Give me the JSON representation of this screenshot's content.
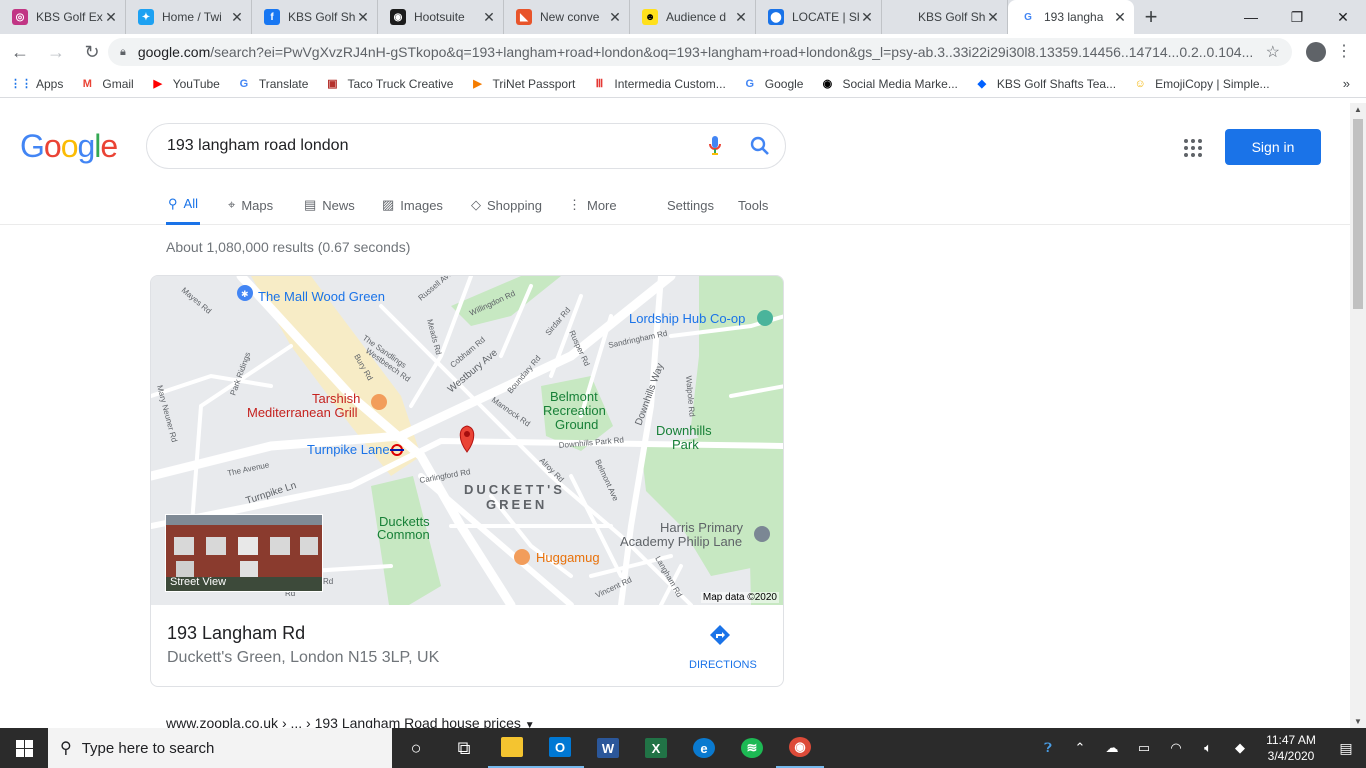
{
  "browser": {
    "tabs": [
      {
        "title": "KBS Golf Ex",
        "icon": "instagram-icon",
        "color": "#c13584",
        "glyph": "◎"
      },
      {
        "title": "Home / Twi",
        "icon": "twitter-icon",
        "color": "#1da1f2",
        "glyph": "✦"
      },
      {
        "title": "KBS Golf Sh",
        "icon": "facebook-icon",
        "color": "#1877f2",
        "glyph": "f"
      },
      {
        "title": "Hootsuite",
        "icon": "hootsuite-icon",
        "color": "#1c1c1c",
        "glyph": "◉"
      },
      {
        "title": "New conve",
        "icon": "zendesk-icon",
        "color": "#e8542a",
        "glyph": "◣"
      },
      {
        "title": "Audience d",
        "icon": "mailchimp-icon",
        "color": "#ffe01b",
        "glyph": "☻"
      },
      {
        "title": "LOCATE | Sh",
        "icon": "location-icon",
        "color": "#1a73e8",
        "glyph": "⬤"
      },
      {
        "title": "KBS Golf Sh",
        "icon": "",
        "color": "#dee1e6",
        "glyph": ""
      },
      {
        "title": "193 langha",
        "icon": "google-icon",
        "color": "#ffffff",
        "glyph": "G",
        "active": true
      }
    ],
    "new_tab": "+",
    "url_host": "google.com",
    "url_rest": "/search?ei=PwVgXvzRJ4nH-gSTkopo&q=193+langham+road+london&oq=193+langham+road+london&gs_l=psy-ab.3..33i22i29i30l8.13359.14456..14714...0.2..0.104...",
    "bookmarks": [
      {
        "label": "Apps",
        "icon": "apps-grid-icon",
        "color": "#1a73e8",
        "glyph": "⋮⋮"
      },
      {
        "label": "Gmail",
        "icon": "gmail-icon",
        "color": "#ea4335",
        "glyph": "M"
      },
      {
        "label": "YouTube",
        "icon": "youtube-icon",
        "color": "#ff0000",
        "glyph": "▶"
      },
      {
        "label": "Translate",
        "icon": "translate-icon",
        "color": "#4285f4",
        "glyph": "G"
      },
      {
        "label": "Taco Truck Creative",
        "icon": "taco-truck-icon",
        "color": "#b5312c",
        "glyph": "▣"
      },
      {
        "label": "TriNet Passport",
        "icon": "trinet-icon",
        "color": "#f57c00",
        "glyph": "▶"
      },
      {
        "label": "Intermedia Custom...",
        "icon": "intermedia-icon",
        "color": "#e53935",
        "glyph": "Ⅲ"
      },
      {
        "label": "Google",
        "icon": "google-icon",
        "color": "#4285f4",
        "glyph": "G"
      },
      {
        "label": "Social Media Marke...",
        "icon": "hootsuite-owl-icon",
        "color": "#000000",
        "glyph": "◉"
      },
      {
        "label": "KBS Golf Shafts Tea...",
        "icon": "dropbox-icon",
        "color": "#0061ff",
        "glyph": "◆"
      },
      {
        "label": "EmojiCopy | Simple...",
        "icon": "emoji-icon",
        "color": "#f4b400",
        "glyph": "☺"
      }
    ]
  },
  "google": {
    "query": "193 langham road london",
    "sign_in": "Sign in",
    "tabs": [
      {
        "label": "All",
        "icon": "search-icon",
        "glyph": "🔍︎"
      },
      {
        "label": "Maps",
        "icon": "map-pin-icon",
        "glyph": "⌖"
      },
      {
        "label": "News",
        "icon": "news-icon",
        "glyph": "▤"
      },
      {
        "label": "Images",
        "icon": "image-icon",
        "glyph": "▨"
      },
      {
        "label": "Shopping",
        "icon": "tag-icon",
        "glyph": "◇"
      },
      {
        "label": "More",
        "icon": "more-vert-icon",
        "glyph": "⋮"
      }
    ],
    "settings": "Settings",
    "tools": "Tools",
    "stats": "About 1,080,000 results (0.67 seconds)",
    "map": {
      "labels": {
        "mall": "The Mall Wood Green",
        "coop": "Lordship Hub Co-op",
        "tarshish1": "Tarshish",
        "tarshish2": "Mediterranean Grill",
        "belmont1": "Belmont",
        "belmont2": "Recreation",
        "belmont3": "Ground",
        "downhills1": "Downhills",
        "downhills2": "Park",
        "turnpike": "Turnpike Lane",
        "duckett1": "DUCKETT'S",
        "duckett2": "GREEN",
        "common1": "Ducketts",
        "common2": "Common",
        "harris1": "Harris Primary",
        "harris2": "Academy Philip Lane",
        "huggamug": "Huggamug"
      },
      "streets": {
        "mayes": "Mayes Rd",
        "russell": "Russell Ave",
        "willingdon": "Willingdon Rd",
        "sirdar": "Sirdar Rd",
        "sandringham": "Sandringham Rd",
        "rusper": "Rusper Rd",
        "meads": "Meads Rd",
        "cobham": "Cobham Rd",
        "westbury": "Westbury Ave",
        "sandlings": "The Sandlings",
        "westbeech": "Westbeech Rd",
        "bury": "Bury Rd",
        "boundary": "Boundary Rd",
        "mannock": "Mannock Rd",
        "downhills_way": "Downhills Way",
        "walpole": "Walpole Rd",
        "park_ridings": "Park Ridings",
        "mary_neuner": "Mary Neuner Rd",
        "downhills_park_rd": "Downhills Park Rd",
        "avenue": "The Avenue",
        "carlingford": "Carlingford Rd",
        "alroy": "Alroy Rd",
        "turnpike_ln": "Turnpike Ln",
        "belmont_ave": "Belmont Ave",
        "langham": "Langham Rd",
        "vincent": "Vincent Rd",
        "rd_a": "Rd",
        "rd_b": "Rd"
      },
      "street_view": "Street View",
      "attribution": "Map data ©2020"
    },
    "place_title": "193 Langham Rd",
    "place_address": "Duckett's Green, London N15 3LP, UK",
    "directions": "DIRECTIONS",
    "next_result": "www.zoopla.co.uk › ... › 193 Langham Road house prices"
  },
  "taskbar": {
    "search_placeholder": "Type here to search",
    "apps": [
      {
        "name": "cortana-icon",
        "glyph": "○"
      },
      {
        "name": "task-view-icon",
        "glyph": "⧉"
      },
      {
        "name": "file-explorer-icon",
        "glyph": "▬",
        "color": "#f4c430",
        "running": true
      },
      {
        "name": "outlook-icon",
        "glyph": "O",
        "color": "#0078d4",
        "running": true
      },
      {
        "name": "word-icon",
        "glyph": "W",
        "color": "#2b579a"
      },
      {
        "name": "excel-icon",
        "glyph": "X",
        "color": "#217346"
      },
      {
        "name": "edge-icon",
        "glyph": "e",
        "color": "#0a7ad0"
      },
      {
        "name": "spotify-icon",
        "glyph": "≋",
        "color": "#1db954"
      },
      {
        "name": "chrome-icon",
        "glyph": "◉",
        "color": "#dd4b39",
        "running": true
      }
    ],
    "time": "11:47 AM",
    "date": "3/4/2020"
  }
}
